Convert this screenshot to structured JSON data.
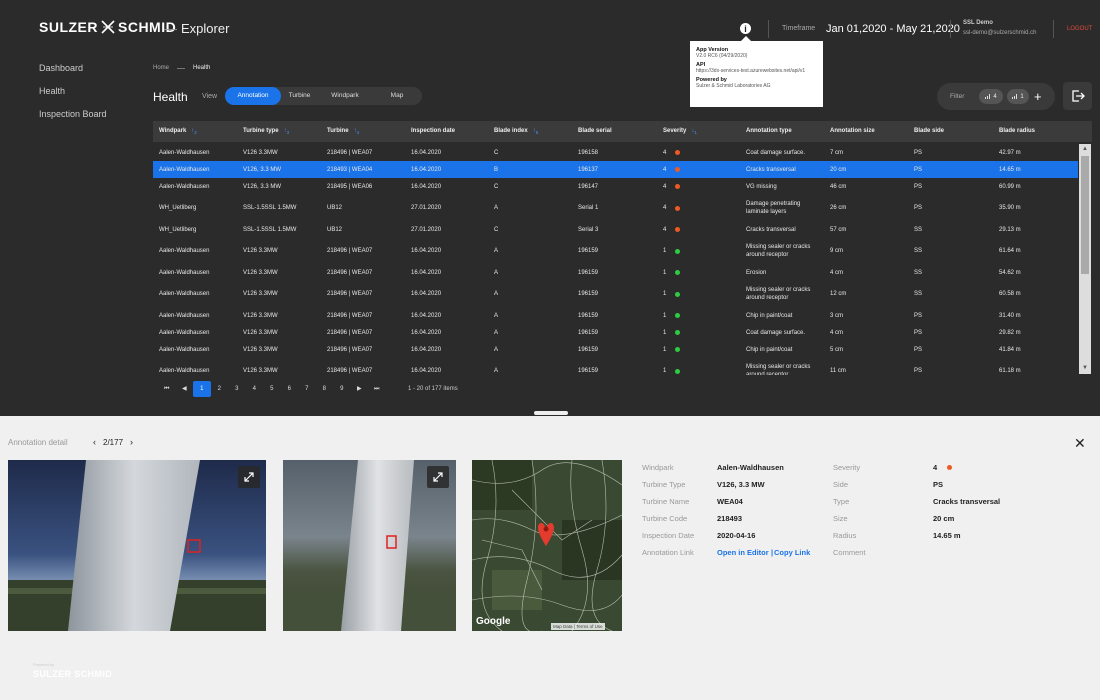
{
  "header": {
    "brand_left": "SULZER",
    "brand_right": "SCHMID",
    "app_separator": "—",
    "app_name": "Explorer",
    "info_icon": "i",
    "timeframe_label": "Timeframe",
    "timeframe_value": "Jan 01,2020 - May 21,2020",
    "user_name": "SSL Demo",
    "user_email": "ssl-demo@sulzerschmid.ch",
    "logout": "LOGOUT"
  },
  "popover": {
    "version_title": "App Version",
    "version_value": "V2.0 RC6 (04/29/2020)",
    "api_title": "API",
    "api_value": "https://3dx-services-test.azurewebsites.net/api/v1",
    "powered_title": "Powered by",
    "powered_value": "Sulzer & Schmid Laboratories AG"
  },
  "sidebar": {
    "items": [
      "Dashboard",
      "Health",
      "Inspection Board"
    ]
  },
  "breadcrumb": {
    "home": "Home",
    "current": "Health"
  },
  "page": {
    "title": "Health",
    "view_label": "View",
    "tabs": [
      "Annotation",
      "Turbine",
      "Windpark",
      "Map"
    ],
    "active_tab": "Annotation"
  },
  "filter": {
    "label": "Filter",
    "chip1": "4",
    "chip2": "1",
    "add": "+"
  },
  "table": {
    "columns": [
      {
        "label": "Windpark",
        "sort": "↑",
        "sort_num": "2"
      },
      {
        "label": "Turbine type",
        "sort": "↑",
        "sort_num": "3"
      },
      {
        "label": "Turbine",
        "sort": "↑",
        "sort_num": "4"
      },
      {
        "label": "Inspection date",
        "sort": "",
        "sort_num": ""
      },
      {
        "label": "Blade index",
        "sort": "↑",
        "sort_num": "5"
      },
      {
        "label": "Blade serial",
        "sort": "",
        "sort_num": ""
      },
      {
        "label": "Severity",
        "sort": "↓",
        "sort_num": "1"
      },
      {
        "label": "Annotation type",
        "sort": "",
        "sort_num": ""
      },
      {
        "label": "Annotation size",
        "sort": "",
        "sort_num": ""
      },
      {
        "label": "Blade side",
        "sort": "",
        "sort_num": ""
      },
      {
        "label": "Blade radius",
        "sort": "",
        "sort_num": ""
      }
    ],
    "rows": [
      [
        "Aalen-Waldhausen",
        "V126 3.3MW",
        "218496 | WEA07",
        "16.04.2020",
        "C",
        "196158",
        "4",
        "Coat damage surface.",
        "7 cm",
        "PS",
        "42.97 m"
      ],
      [
        "Aalen-Waldhausen",
        "V126, 3.3 MW",
        "218493 | WEA04",
        "16.04.2020",
        "B",
        "196137",
        "4",
        "Cracks transversal",
        "20 cm",
        "PS",
        "14.65 m"
      ],
      [
        "Aalen-Waldhausen",
        "V126, 3.3 MW",
        "218495 | WEA06",
        "16.04.2020",
        "C",
        "196147",
        "4",
        "VG missing",
        "46 cm",
        "PS",
        "60.99 m"
      ],
      [
        "WH_Uetliberg",
        "SSL-1.5SSL 1.5MW",
        "UB12",
        "27.01.2020",
        "A",
        "Serial 1",
        "4",
        "Damage penetrating laminate layers",
        "26 cm",
        "PS",
        "35.90 m"
      ],
      [
        "WH_Uetliberg",
        "SSL-1.5SSL 1.5MW",
        "UB12",
        "27.01.2020",
        "C",
        "Serial 3",
        "4",
        "Cracks transversal",
        "57 cm",
        "SS",
        "29.13 m"
      ],
      [
        "Aalen-Waldhausen",
        "V126 3.3MW",
        "218496 | WEA07",
        "16.04.2020",
        "A",
        "196159",
        "1",
        "Missing sealer or cracks around receptor",
        "9 cm",
        "SS",
        "61.64 m"
      ],
      [
        "Aalen-Waldhausen",
        "V126 3.3MW",
        "218496 | WEA07",
        "16.04.2020",
        "A",
        "196159",
        "1",
        "Erosion",
        "4 cm",
        "SS",
        "54.62 m"
      ],
      [
        "Aalen-Waldhausen",
        "V126 3.3MW",
        "218496 | WEA07",
        "16.04.2020",
        "A",
        "196159",
        "1",
        "Missing sealer or cracks around receptor",
        "12 cm",
        "SS",
        "60.58 m"
      ],
      [
        "Aalen-Waldhausen",
        "V126 3.3MW",
        "218496 | WEA07",
        "16.04.2020",
        "A",
        "196159",
        "1",
        "Chip in paint/coat",
        "3 cm",
        "PS",
        "31.40 m"
      ],
      [
        "Aalen-Waldhausen",
        "V126 3.3MW",
        "218496 | WEA07",
        "16.04.2020",
        "A",
        "196159",
        "1",
        "Coat damage surface.",
        "4 cm",
        "PS",
        "29.82 m"
      ],
      [
        "Aalen-Waldhausen",
        "V126 3.3MW",
        "218496 | WEA07",
        "16.04.2020",
        "A",
        "196159",
        "1",
        "Chip in paint/coat",
        "5 cm",
        "PS",
        "41.84 m"
      ],
      [
        "Aalen-Waldhausen",
        "V126 3.3MW",
        "218496 | WEA07",
        "16.04.2020",
        "A",
        "196159",
        "1",
        "Missing sealer or cracks around receptor",
        "11 cm",
        "PS",
        "61.18 m"
      ]
    ],
    "selected_row": 1
  },
  "pagination": {
    "first": "⏮",
    "prev": "◀",
    "pages": [
      "1",
      "2",
      "3",
      "4",
      "5",
      "6",
      "7",
      "8",
      "9"
    ],
    "current": "1",
    "next": "▶",
    "last": "⏭",
    "info": "1 - 20 of 177 items"
  },
  "detail": {
    "title": "Annotation detail",
    "counter": "2/177",
    "prev": "‹",
    "next": "›",
    "close": "✕",
    "left_fields": [
      {
        "label": "Windpark",
        "value": "Aalen-Waldhausen"
      },
      {
        "label": "Turbine Type",
        "value": "V126, 3.3 MW"
      },
      {
        "label": "Turbine Name",
        "value": "WEA04"
      },
      {
        "label": "Turbine Code",
        "value": "218493"
      },
      {
        "label": "Inspection Date",
        "value": "2020-04-16"
      }
    ],
    "annotation_link_label": "Annotation Link",
    "open_editor": "Open in Editor",
    "link_sep": "|",
    "copy_link": "Copy Link",
    "right_fields": [
      {
        "label": "Severity",
        "value": "4"
      },
      {
        "label": "Side",
        "value": "PS"
      },
      {
        "label": "Type",
        "value": "Cracks transversal"
      },
      {
        "label": "Size",
        "value": "20 cm"
      },
      {
        "label": "Radius",
        "value": "14.65 m"
      },
      {
        "label": "Comment",
        "value": ""
      }
    ],
    "map_brand": "Google",
    "map_footer": "Map Data | Terms of Use"
  },
  "footer": {
    "small": "Powered by",
    "brand": "SULZER SCHMID"
  },
  "colors": {
    "accent": "#1a73e8",
    "severity_high": "#ef5a22",
    "severity_low": "#2ecc40",
    "logout": "#e14b3c"
  }
}
